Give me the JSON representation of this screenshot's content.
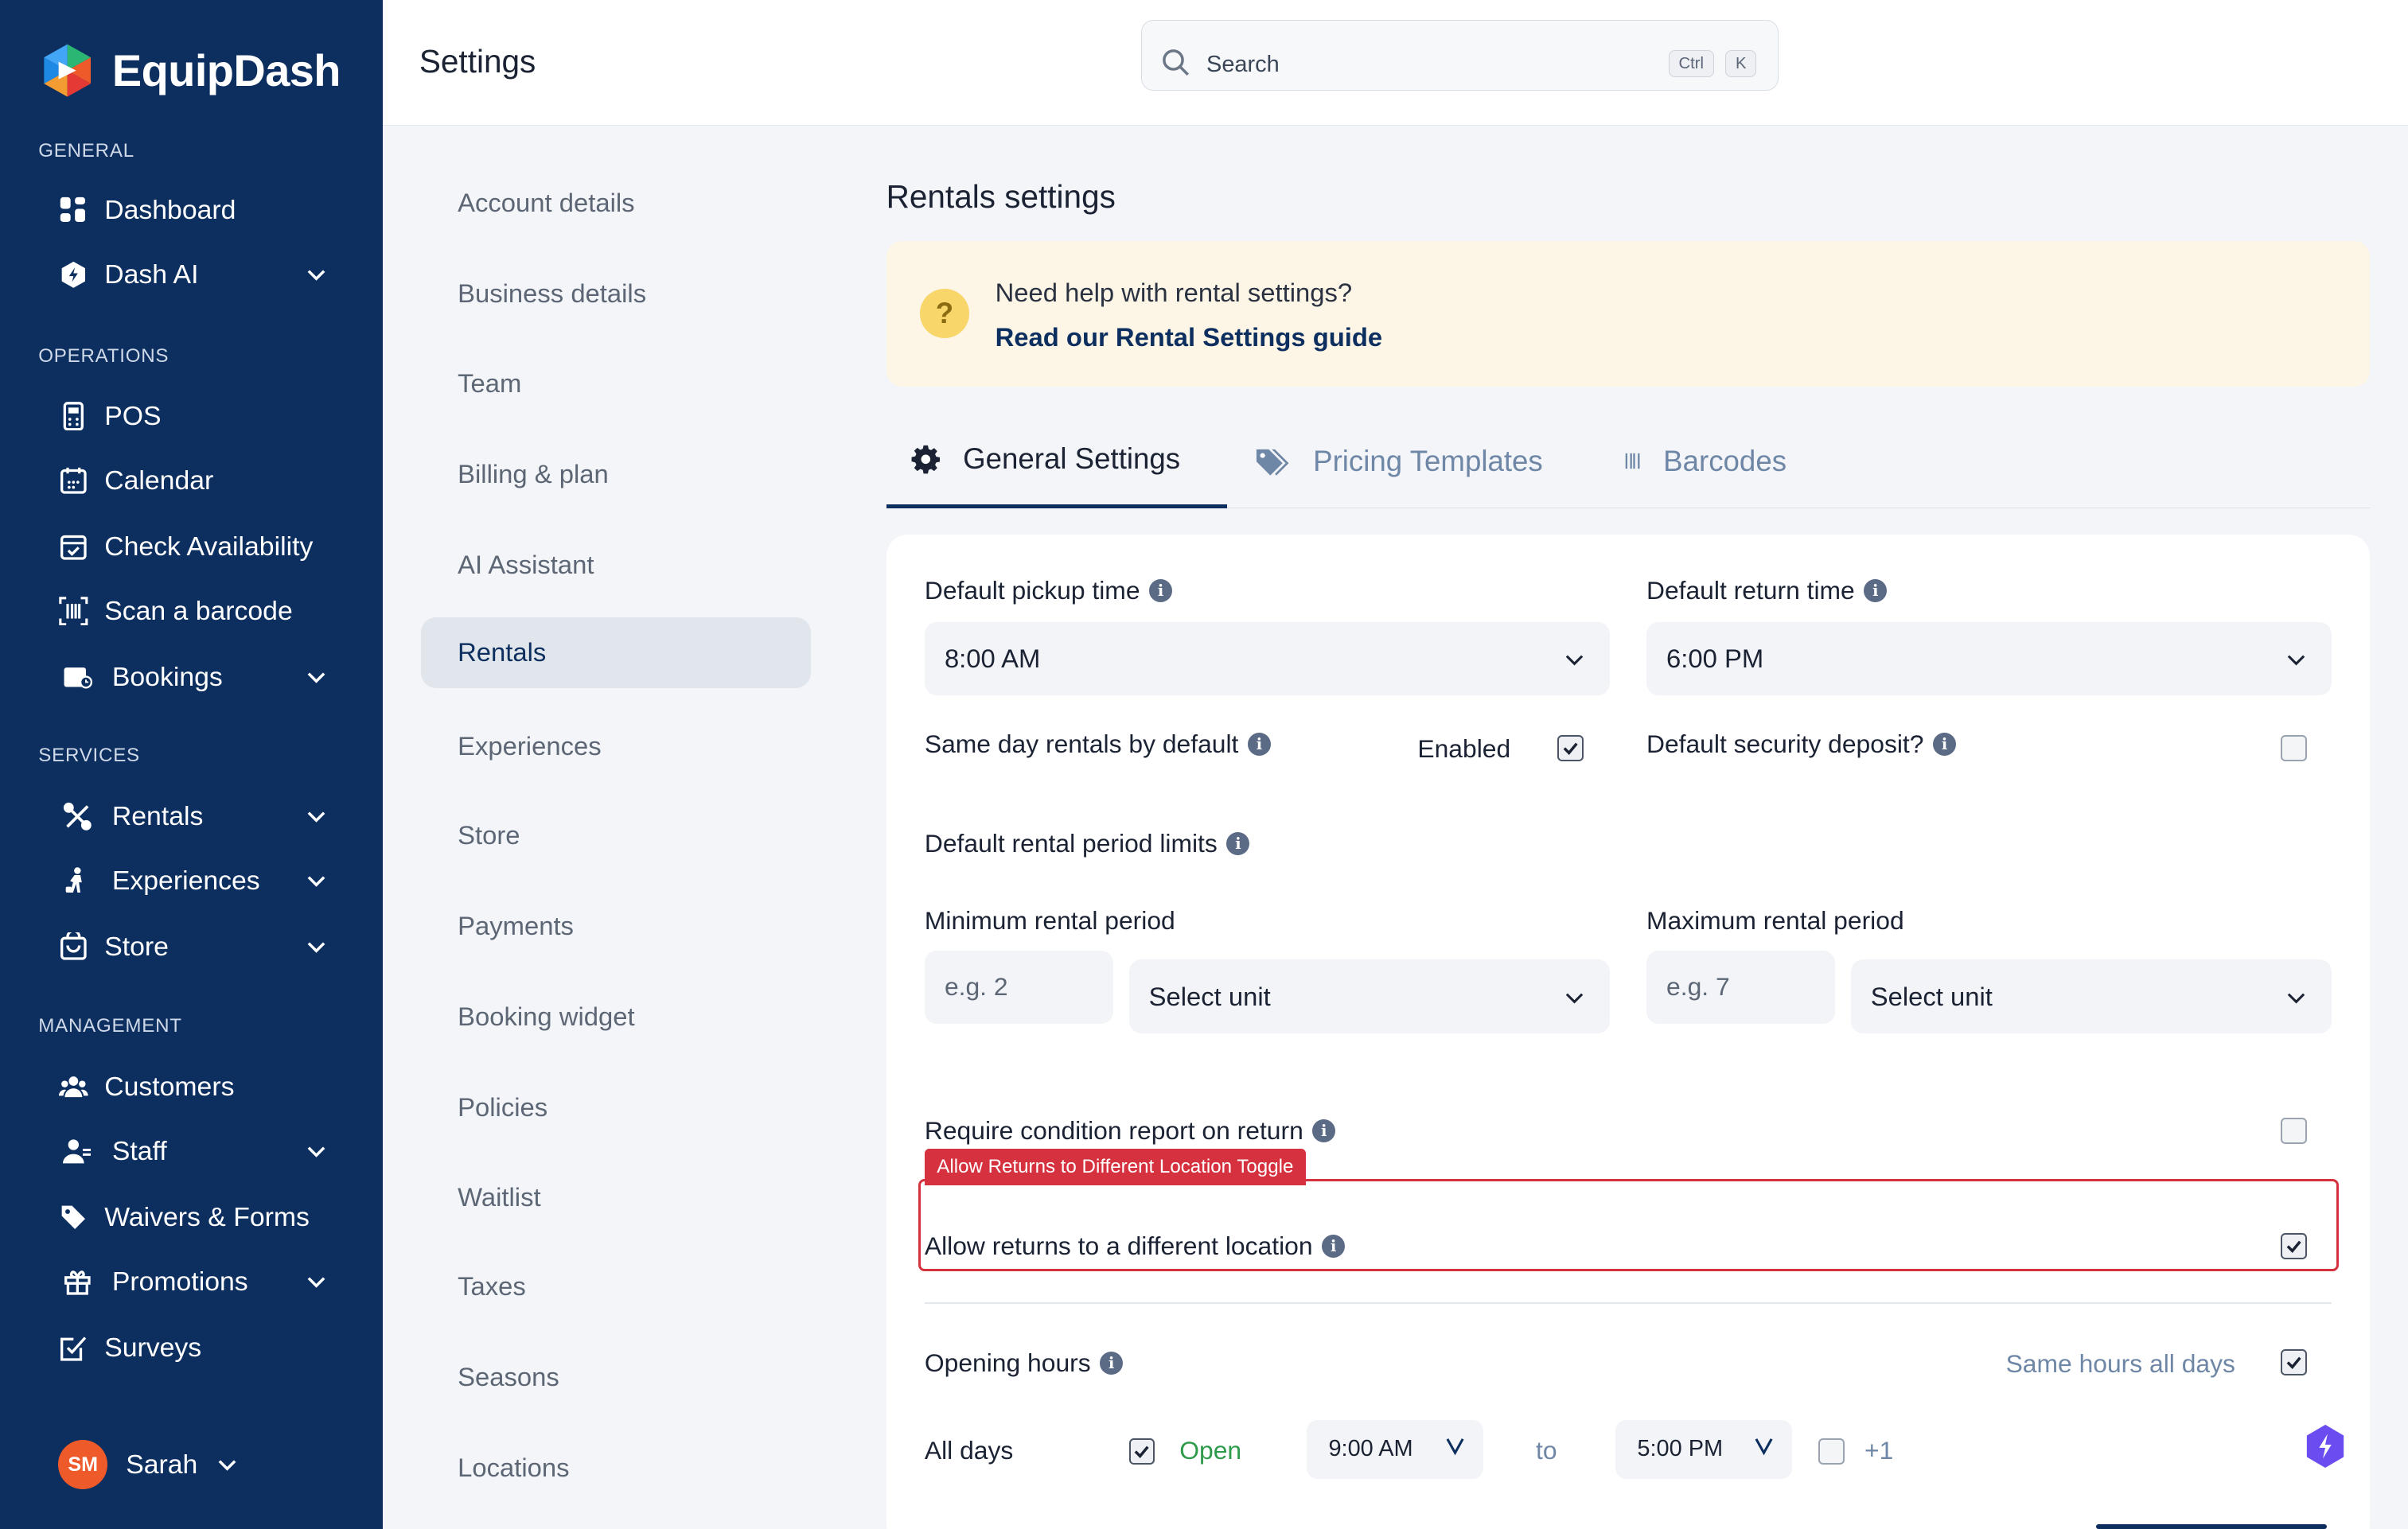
{
  "app": {
    "name": "EquipDash"
  },
  "header": {
    "title": "Settings",
    "search_placeholder": "Search",
    "kbd_ctrl": "Ctrl",
    "kbd_k": "K"
  },
  "sidebar": {
    "sections": {
      "general": "GENERAL",
      "operations": "OPERATIONS",
      "services": "SERVICES",
      "management": "MANAGEMENT"
    },
    "items": [
      {
        "label": "Dashboard",
        "icon": "dashboard-icon"
      },
      {
        "label": "Dash AI",
        "icon": "ai-icon"
      },
      {
        "label": "POS",
        "icon": "pos-icon"
      },
      {
        "label": "Calendar",
        "icon": "calendar-icon"
      },
      {
        "label": "Check Availability",
        "icon": "calendar-check-icon"
      },
      {
        "label": "Scan a barcode",
        "icon": "barcode-scan-icon"
      },
      {
        "label": "Bookings",
        "icon": "bookings-icon"
      },
      {
        "label": "Rentals",
        "icon": "rentals-icon"
      },
      {
        "label": "Experiences",
        "icon": "experiences-icon"
      },
      {
        "label": "Store",
        "icon": "store-icon"
      },
      {
        "label": "Customers",
        "icon": "customers-icon"
      },
      {
        "label": "Staff",
        "icon": "staff-icon"
      },
      {
        "label": "Waivers & Forms",
        "icon": "tag-icon"
      },
      {
        "label": "Promotions",
        "icon": "gift-icon"
      },
      {
        "label": "Surveys",
        "icon": "survey-icon"
      }
    ],
    "user": {
      "initials": "SM",
      "name": "Sarah"
    }
  },
  "subnav": [
    "Account details",
    "Business details",
    "Team",
    "Billing & plan",
    "AI Assistant",
    "Rentals",
    "Experiences",
    "Store",
    "Payments",
    "Booking widget",
    "Policies",
    "Waitlist",
    "Taxes",
    "Seasons",
    "Locations"
  ],
  "main": {
    "title": "Rentals settings",
    "help": {
      "question": "Need help with rental settings?",
      "link": "Read our Rental Settings guide"
    },
    "tabs": [
      "General Settings",
      "Pricing Templates",
      "Barcodes"
    ],
    "form": {
      "pickup_label": "Default pickup time",
      "pickup_value": "8:00 AM",
      "return_label": "Default return time",
      "return_value": "6:00 PM",
      "same_day_label": "Same day rentals by default",
      "same_day_state": "Enabled",
      "deposit_label": "Default security deposit?",
      "period_limits_label": "Default rental period limits",
      "min_label": "Minimum rental period",
      "min_placeholder": "e.g. 2",
      "min_unit": "Select unit",
      "max_label": "Maximum rental period",
      "max_placeholder": "e.g. 7",
      "max_unit": "Select unit",
      "condition_label": "Require condition report on return",
      "callout_tag": "Allow Returns to Different Location Toggle",
      "different_location_label": "Allow returns to a different location",
      "opening_hours_label": "Opening hours",
      "same_hours_label": "Same hours all days",
      "all_days_label": "All days",
      "open_label": "Open",
      "open_time": "9:00 AM",
      "to_label": "to",
      "close_time": "5:00 PM",
      "plus_one": "+1"
    }
  },
  "colors": {
    "sidebar": "#0d2f5f",
    "accent": "#0d2f5f",
    "callout": "#d6313f",
    "open_green": "#2e9b4b",
    "help_bg": "#fdf6e6"
  }
}
